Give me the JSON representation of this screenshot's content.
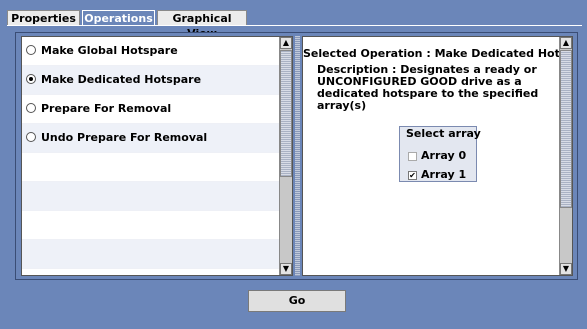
{
  "tabs": [
    {
      "label": "Properties"
    },
    {
      "label": "Operations"
    },
    {
      "label": "Graphical View"
    }
  ],
  "operations": {
    "options": [
      {
        "label": "Make Global Hotspare",
        "selected": false
      },
      {
        "label": "Make Dedicated Hotspare",
        "selected": true
      },
      {
        "label": "Prepare For Removal",
        "selected": false
      },
      {
        "label": "Undo Prepare For Removal",
        "selected": false
      }
    ]
  },
  "details": {
    "selected_operation": "Selected Operation : Make Dedicated Hotspare",
    "description": "Description : Designates a ready or UNCONFIGURED GOOD drive as a dedicated hotspare to the specified array(s)",
    "array_group_label": "Select array",
    "arrays": [
      {
        "label": "Array 0",
        "checked": false,
        "enabled": false
      },
      {
        "label": "Array 1",
        "checked": true,
        "enabled": true
      }
    ]
  },
  "go_button": {
    "label": "Go"
  },
  "icons": {
    "scroll_up": "arrow-up",
    "scroll_down": "arrow-down"
  }
}
